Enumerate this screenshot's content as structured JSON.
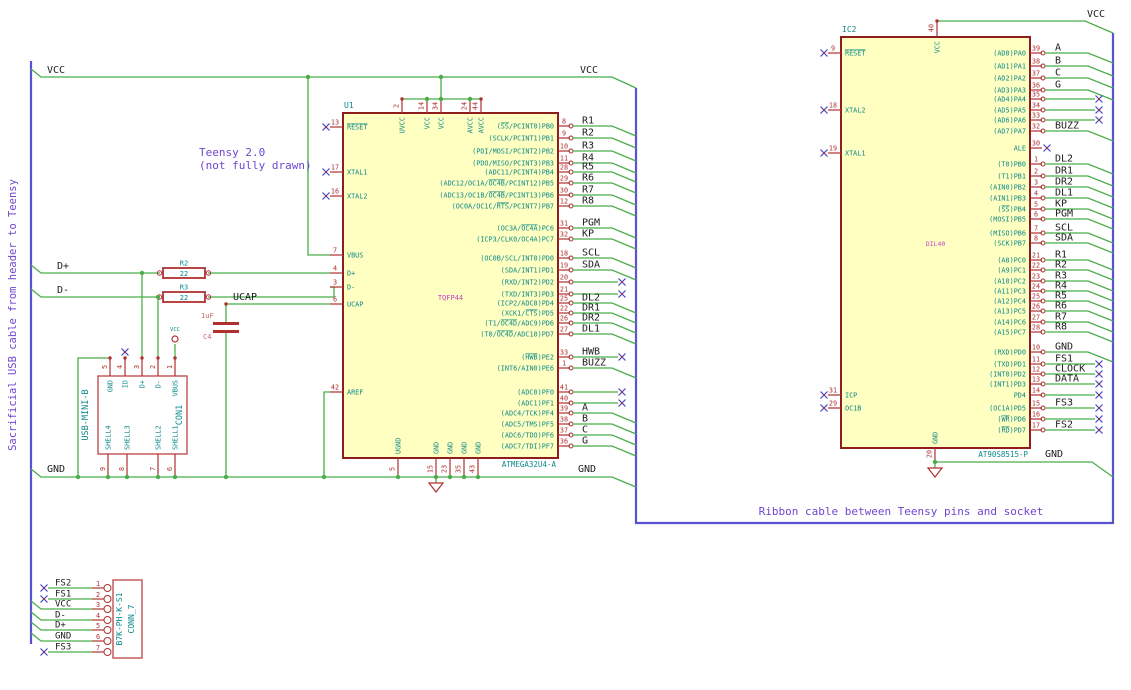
{
  "notes": {
    "sacrificial": "Sacrificial USB cable from header to Teensy",
    "teensy_line1": "Teensy 2.0",
    "teensy_line2": "(not fully drawn)",
    "ribbon": "Ribbon cable between Teensy pins and socket"
  },
  "net_labels": {
    "vcc": "VCC",
    "gnd": "GND",
    "dplus": "D+",
    "dminus": "D-",
    "ucap": "UCAP"
  },
  "colors": {
    "wire": "#4aad4a",
    "bus": "#5753d2",
    "chip_outline": "#8f1d1d",
    "chip_fill": "#ffffc2",
    "pin": "#b03030",
    "pin_name": "#0d8989",
    "field_magenta": "#c743c7",
    "net_label": "#1c1c1c",
    "note": "#6e46cf",
    "nc": "#4646c8",
    "component_outline": "#c05050",
    "cap_field": "#c66a6a"
  },
  "u1": {
    "ref": "U1",
    "footprint": "TQFP44",
    "value": "ATMEGA32U4-A",
    "left_pins": [
      {
        "num": "13",
        "name": "~RESET~",
        "nc": true
      },
      {
        "num": "17",
        "name": "XTAL1",
        "nc": true
      },
      {
        "num": "16",
        "name": "XTAL2",
        "nc": true
      },
      {
        "num": "7",
        "name": "VBUS"
      },
      {
        "num": "4",
        "name": "D+"
      },
      {
        "num": "3",
        "name": "D-"
      },
      {
        "num": "6",
        "name": "UCAP"
      },
      {
        "num": "42",
        "name": "AREF"
      }
    ],
    "top_pins": [
      {
        "num": "2",
        "name": "UVCC"
      },
      {
        "num": "14",
        "name": "VCC"
      },
      {
        "num": "34",
        "name": "VCC"
      },
      {
        "num": "24",
        "name": "AVCC"
      },
      {
        "num": "44",
        "name": "AVCC"
      }
    ],
    "bottom_pins": [
      {
        "num": "5",
        "name": "UGND"
      },
      {
        "num": "15",
        "name": "GND"
      },
      {
        "num": "23",
        "name": "GND"
      },
      {
        "num": "35",
        "name": "GND"
      },
      {
        "num": "43",
        "name": "GND"
      }
    ],
    "right_pins": [
      {
        "num": "8",
        "name": "(~SS~/PCINT0)PB0",
        "net": "R1",
        "conn": "bus"
      },
      {
        "num": "9",
        "name": "(SCLK/PCINT1)PB1",
        "net": "R2",
        "conn": "bus"
      },
      {
        "num": "10",
        "name": "(PDI/MOSI/PCINT2)PB2",
        "net": "R3",
        "conn": "bus"
      },
      {
        "num": "11",
        "name": "(PDO/MISO/PCINT3)PB3",
        "net": "R4",
        "conn": "bus"
      },
      {
        "num": "28",
        "name": "(ADC11/PCINT4)PB4",
        "net": "R5",
        "conn": "bus"
      },
      {
        "num": "29",
        "name": "(ADC12/OC1A/~OC4B~/PCINT12)PB5",
        "net": "R6",
        "conn": "bus"
      },
      {
        "num": "30",
        "name": "(ADC13/OC1B/~OC4B~/PCINT13)PB6",
        "net": "R7",
        "conn": "bus"
      },
      {
        "num": "12",
        "name": "(OC0A/OC1C/~RTS~/PCINT7)PB7",
        "net": "R8",
        "conn": "bus"
      },
      {
        "num": "31",
        "name": "(OC3A/~OC4A~)PC6",
        "net": "PGM",
        "conn": "bus"
      },
      {
        "num": "32",
        "name": "(ICP3/CLK0/OC4A)PC7",
        "net": "KP",
        "conn": "bus"
      },
      {
        "num": "18",
        "name": "(OC0B/SCL/INT0)PD0",
        "net": "SCL",
        "conn": "bus"
      },
      {
        "num": "19",
        "name": "(SDA/INT1)PD1",
        "net": "SDA",
        "conn": "bus"
      },
      {
        "num": "20",
        "name": "(RXD/INT2)PD2",
        "net": "",
        "conn": "nc"
      },
      {
        "num": "21",
        "name": "(TXD/INT3)PD3",
        "net": "",
        "conn": "nc"
      },
      {
        "num": "25",
        "name": "(ICP2/ADC8)PD4",
        "net": "DL2",
        "conn": "bus"
      },
      {
        "num": "22",
        "name": "(XCK1/~CTS~)PD5",
        "net": "DR1",
        "conn": "bus"
      },
      {
        "num": "26",
        "name": "(T1/~OC4D~/ADC9)PD6",
        "net": "DR2",
        "conn": "bus"
      },
      {
        "num": "27",
        "name": "(T0/~OC4D~/ADC10)PD7",
        "net": "DL1",
        "conn": "bus"
      },
      {
        "num": "33",
        "name": "(~HWB~)PE2",
        "net": "HWB",
        "conn": "nc_label"
      },
      {
        "num": "1",
        "name": "(INT6/AIN0)PE6",
        "net": "BUZZ",
        "conn": "bus"
      },
      {
        "num": "41",
        "name": "(ADC0)PF0",
        "net": "",
        "conn": "nc"
      },
      {
        "num": "40",
        "name": "(ADC1)PF1",
        "net": "",
        "conn": "nc"
      },
      {
        "num": "39",
        "name": "(ADC4/TCK)PF4",
        "net": "A",
        "conn": "bus"
      },
      {
        "num": "38",
        "name": "(ADC5/TMS)PF5",
        "net": "B",
        "conn": "bus"
      },
      {
        "num": "37",
        "name": "(ADC6/TDO)PF6",
        "net": "C",
        "conn": "bus"
      },
      {
        "num": "36",
        "name": "(ADC7/TDI)PF7",
        "net": "G",
        "conn": "bus"
      }
    ]
  },
  "ic2": {
    "ref": "IC2",
    "footprint": "DIL40",
    "value": "AT90S8515-P",
    "left_pins": [
      {
        "num": "9",
        "name": "~RESET~",
        "nc": true
      },
      {
        "num": "18",
        "name": "XTAL2",
        "nc": true
      },
      {
        "num": "19",
        "name": "XTAL1",
        "nc": true
      },
      {
        "num": "31",
        "name": "ICP",
        "nc": true
      },
      {
        "num": "29",
        "name": "OC1B",
        "nc": true
      }
    ],
    "top_pins": [
      {
        "num": "40",
        "name": "VCC"
      }
    ],
    "bottom_pins": [
      {
        "num": "20",
        "name": "GND"
      }
    ],
    "right_pins": [
      {
        "num": "39",
        "name": "(AD0)PA0",
        "net": "A",
        "conn": "bus"
      },
      {
        "num": "38",
        "name": "(AD1)PA1",
        "net": "B",
        "conn": "bus"
      },
      {
        "num": "37",
        "name": "(AD2)PA2",
        "net": "C",
        "conn": "bus"
      },
      {
        "num": "36",
        "name": "(AD3)PA3",
        "net": "G",
        "conn": "bus"
      },
      {
        "num": "35",
        "name": "(AD4)PA4",
        "net": "",
        "conn": "nc"
      },
      {
        "num": "34",
        "name": "(AD5)PA5",
        "net": "",
        "conn": "nc"
      },
      {
        "num": "33",
        "name": "(AD6)PA6",
        "net": "",
        "conn": "nc"
      },
      {
        "num": "32",
        "name": "(AD7)PA7",
        "net": "BUZZ",
        "conn": "bus"
      },
      {
        "num": "30",
        "name": "ALE",
        "net": "",
        "conn": "nc_stub"
      },
      {
        "num": "1",
        "name": "(T0)PB0",
        "net": "DL2",
        "conn": "bus"
      },
      {
        "num": "2",
        "name": "(T1)PB1",
        "net": "DR1",
        "conn": "bus"
      },
      {
        "num": "3",
        "name": "(AIN0)PB2",
        "net": "DR2",
        "conn": "bus"
      },
      {
        "num": "4",
        "name": "(AIN1)PB3",
        "net": "DL1",
        "conn": "bus"
      },
      {
        "num": "5",
        "name": "(~SS~)PB4",
        "net": "KP",
        "conn": "bus"
      },
      {
        "num": "6",
        "name": "(MOSI)PB5",
        "net": "PGM",
        "conn": "bus"
      },
      {
        "num": "7",
        "name": "(MISO)PB6",
        "net": "SCL",
        "conn": "bus"
      },
      {
        "num": "8",
        "name": "(SCK)PB7",
        "net": "SDA",
        "conn": "bus"
      },
      {
        "num": "21",
        "name": "(A8)PC0",
        "net": "R1",
        "conn": "bus"
      },
      {
        "num": "22",
        "name": "(A9)PC1",
        "net": "R2",
        "conn": "bus"
      },
      {
        "num": "23",
        "name": "(A10)PC2",
        "net": "R3",
        "conn": "bus"
      },
      {
        "num": "24",
        "name": "(A11)PC3",
        "net": "R4",
        "conn": "bus"
      },
      {
        "num": "25",
        "name": "(A12)PC4",
        "net": "R5",
        "conn": "bus"
      },
      {
        "num": "26",
        "name": "(A13)PC5",
        "net": "R6",
        "conn": "bus"
      },
      {
        "num": "27",
        "name": "(A14)PC6",
        "net": "R7",
        "conn": "bus"
      },
      {
        "num": "28",
        "name": "(A15)PC7",
        "net": "R8",
        "conn": "bus"
      },
      {
        "num": "10",
        "name": "(RXD)PD0",
        "net": "GND",
        "conn": "bus"
      },
      {
        "num": "11",
        "name": "(TXD)PD1",
        "net": "FS1",
        "conn": "nc_label"
      },
      {
        "num": "12",
        "name": "(INT0)PD2",
        "net": "CLOCK",
        "conn": "nc_label"
      },
      {
        "num": "13",
        "name": "(INT1)PD3",
        "net": "DATA",
        "conn": "nc_label"
      },
      {
        "num": "14",
        "name": "PD4",
        "net": "",
        "conn": "nc"
      },
      {
        "num": "15",
        "name": "(OC1A)PD5",
        "net": "FS3",
        "conn": "nc_label"
      },
      {
        "num": "16",
        "name": "(~WR~)PD6",
        "net": "",
        "conn": "nc"
      },
      {
        "num": "17",
        "name": "(~RD~)PD7",
        "net": "FS2",
        "conn": "nc_label"
      }
    ]
  },
  "con1": {
    "ref": "CON1",
    "value": "USB-MINI-B",
    "top_pins": [
      {
        "num": "5",
        "name": "GND"
      },
      {
        "num": "4",
        "name": "ID"
      },
      {
        "num": "3",
        "name": "D+"
      },
      {
        "num": "2",
        "name": "D-"
      },
      {
        "num": "1",
        "name": "VBUS"
      }
    ],
    "bottom_pins": [
      {
        "num": "9",
        "name": "SHELL4"
      },
      {
        "num": "8",
        "name": "SHELL3"
      },
      {
        "num": "7",
        "name": "SHELL2"
      },
      {
        "num": "6",
        "name": "SHELL1"
      }
    ],
    "power_symbol": "VCC"
  },
  "conn7": {
    "ref": "CONN_7",
    "value": "B7K-PH-K-S1",
    "pins": [
      {
        "num": "1",
        "net": "FS2",
        "conn": "nc"
      },
      {
        "num": "2",
        "net": "FS1",
        "conn": "nc"
      },
      {
        "num": "3",
        "net": "VCC",
        "conn": "bus"
      },
      {
        "num": "4",
        "net": "D-",
        "conn": "bus"
      },
      {
        "num": "5",
        "net": "D+",
        "conn": "bus"
      },
      {
        "num": "6",
        "net": "GND",
        "conn": "bus"
      },
      {
        "num": "7",
        "net": "FS3",
        "conn": "nc"
      }
    ]
  },
  "r2": {
    "ref": "R2",
    "value": "22"
  },
  "r3": {
    "ref": "R3",
    "value": "22"
  },
  "c4": {
    "ref": "C4",
    "value": "1uF"
  }
}
